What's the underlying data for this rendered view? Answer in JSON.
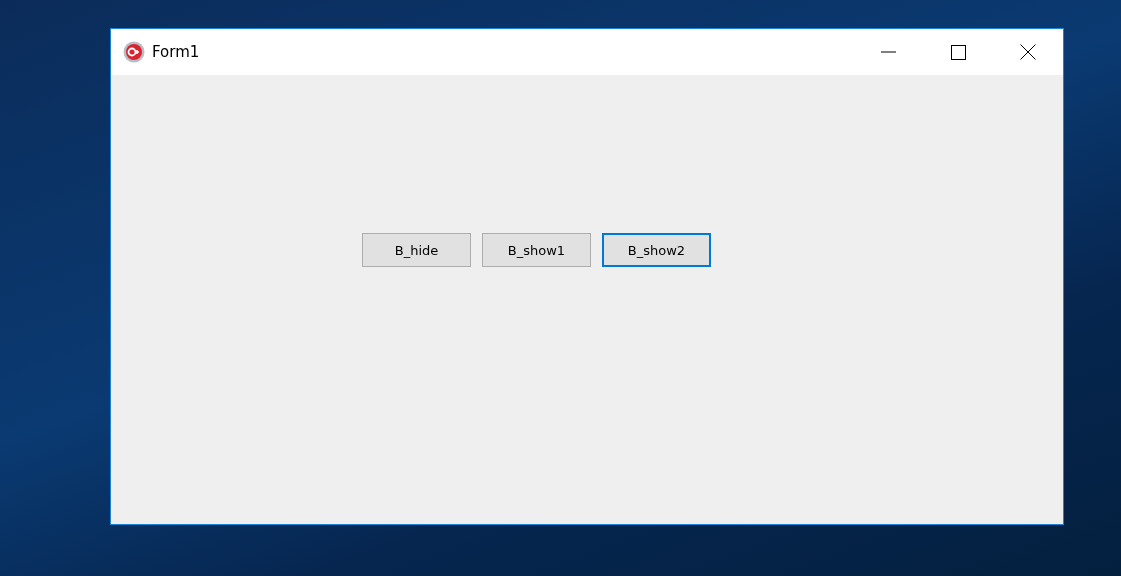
{
  "window": {
    "title": "Form1"
  },
  "buttons": [
    {
      "label": "B_hide",
      "focused": false
    },
    {
      "label": "B_show1",
      "focused": false
    },
    {
      "label": "B_show2",
      "focused": true
    }
  ]
}
